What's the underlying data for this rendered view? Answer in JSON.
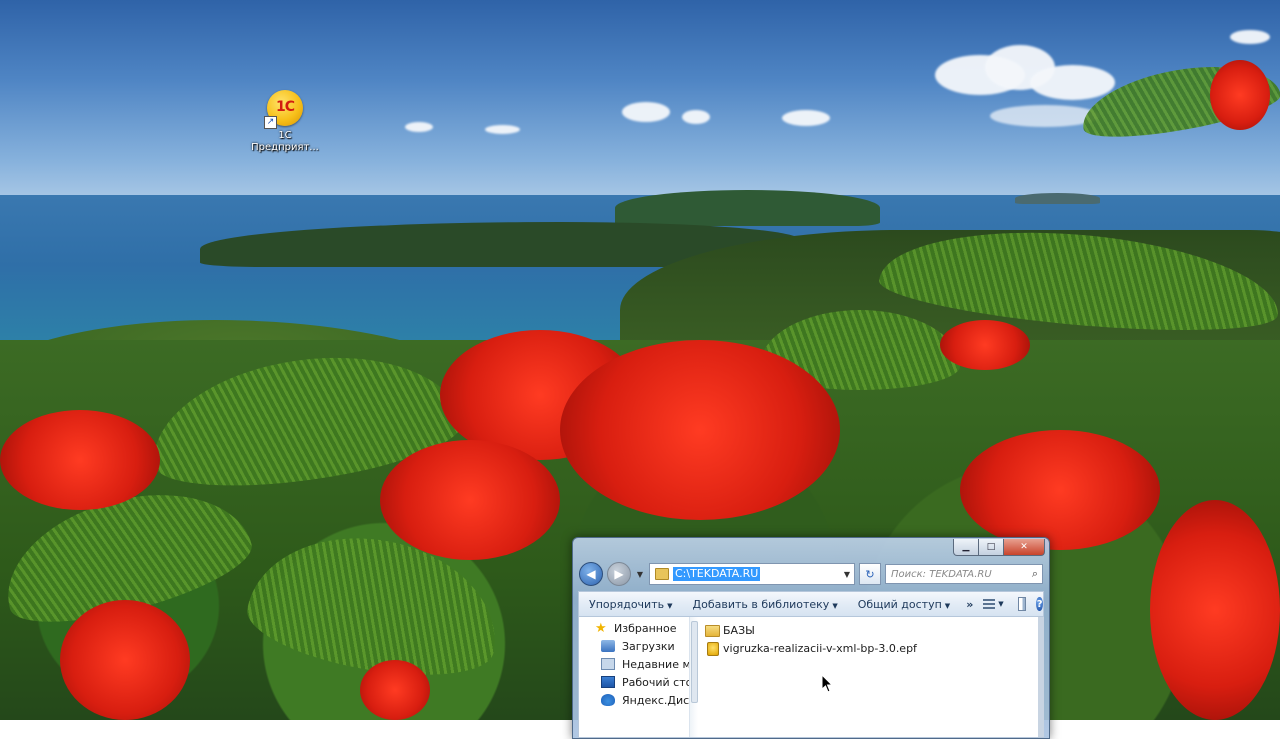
{
  "desktop": {
    "icon_label": "1С\nПредприят..."
  },
  "window": {
    "address_path": "C:\\TEKDATA.RU",
    "search_placeholder": "Поиск: TEKDATA.RU",
    "toolbar": {
      "organize": "Упорядочить",
      "add_to_library": "Добавить в библиотеку",
      "share": "Общий доступ",
      "more": "»"
    },
    "nav_pane": {
      "favorites": "Избранное",
      "items": [
        "Загрузки",
        "Недавние мест",
        "Рабочий стол",
        "Яндекс.Диск"
      ]
    },
    "files": [
      {
        "name": "БАЗЫ",
        "type": "folder"
      },
      {
        "name": "vigruzka-realizacii-v-xml-bp-3.0.epf",
        "type": "epf"
      }
    ]
  }
}
